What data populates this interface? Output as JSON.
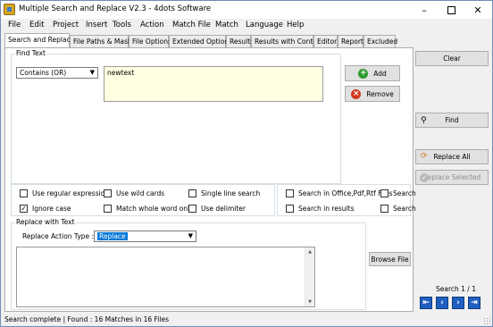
{
  "window": {
    "title": "Multiple Search and Replace V2.3 - 4dots Software"
  },
  "menu": [
    "File",
    "Edit",
    "Project",
    "Insert",
    "Tools",
    "Action",
    "Match File",
    "Match",
    "Language",
    "Help"
  ],
  "tabs": [
    "Search and Replace",
    "File Paths & Masks",
    "File Options",
    "Extended Options",
    "Results",
    "Results with Context",
    "Editor",
    "Report",
    "Excluded"
  ],
  "find": {
    "group_label": "Find Text",
    "type_value": "Contains (OR)",
    "text_value": "newtext",
    "add_label": "Add",
    "remove_label": "Remove"
  },
  "options": {
    "use_regex": "Use regular expression",
    "use_wildcards": "Use wild cards",
    "single_line": "Single line search",
    "ignore_case": "Ignore case",
    "match_whole_word": "Match whole word only",
    "use_delimiter": "Use delimiter",
    "ignore_case_checked": true,
    "search_office": "Search in Office,Pdf,Rtf Files",
    "search_results": "Search in results",
    "search_a": "Search",
    "search_b": "Search"
  },
  "replace": {
    "group_label": "Replace with Text",
    "action_type_label": "Replace Action Type :",
    "action_type_value": "Replace",
    "browse_label": "Browse File"
  },
  "sidebar": {
    "clear_label": "Clear",
    "find_label": "Find",
    "replace_all_label": "Replace All",
    "replace_selected_label": "Replace Selected",
    "search_counter": "Search 1 / 1"
  },
  "status": {
    "text": "Search complete | Found : 16 Matches in 16 Files"
  },
  "colors": {
    "add_icon": "#2e9a2e",
    "remove_icon": "#d2361f",
    "nav_button": "#1f5fc0"
  }
}
